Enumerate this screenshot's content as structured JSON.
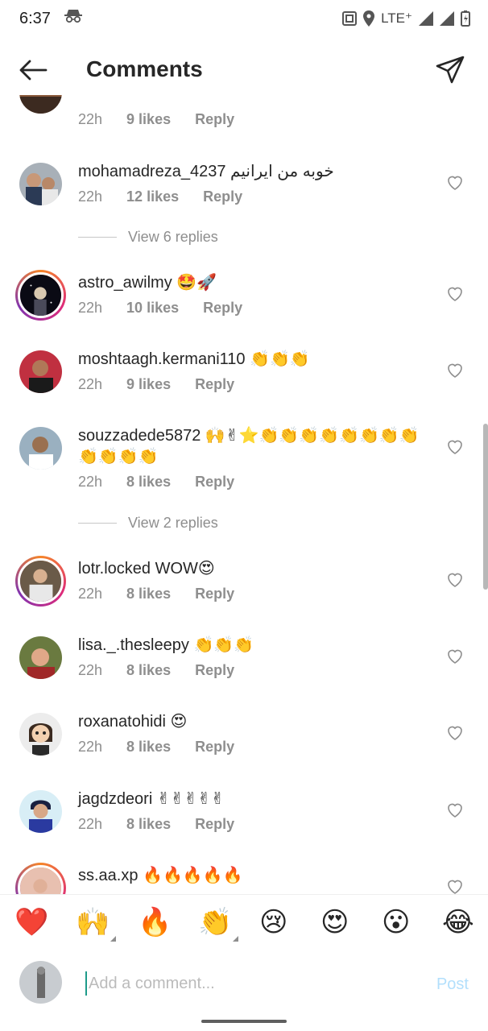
{
  "status_bar": {
    "time": "6:37",
    "network": "LTE⁺"
  },
  "header": {
    "title": "Comments"
  },
  "comments": [
    {
      "username": "",
      "text": "",
      "time": "22h",
      "likes": "9 likes",
      "reply": "Reply"
    },
    {
      "username": "mohamadreza_4237",
      "text": "خوبه من ایرانیم",
      "time": "22h",
      "likes": "12 likes",
      "reply": "Reply"
    },
    {
      "username": "astro_awilmy",
      "text": "🤩🚀",
      "time": "22h",
      "likes": "10 likes",
      "reply": "Reply"
    },
    {
      "username": "moshtaagh.kermani110",
      "text": "👏👏👏",
      "time": "22h",
      "likes": "9 likes",
      "reply": "Reply"
    },
    {
      "username": "souzzadede5872",
      "text": "🙌✌⭐👏👏👏👏👏👏👏👏👏👏👏👏",
      "time": "22h",
      "likes": "8 likes",
      "reply": "Reply"
    },
    {
      "username": "lotr.locked",
      "text": "WOW😍",
      "time": "22h",
      "likes": "8 likes",
      "reply": "Reply"
    },
    {
      "username": "lisa._.thesleepy",
      "text": "👏👏👏",
      "time": "22h",
      "likes": "8 likes",
      "reply": "Reply"
    },
    {
      "username": "roxanatohidi",
      "text": "😍",
      "time": "22h",
      "likes": "8 likes",
      "reply": "Reply"
    },
    {
      "username": "jagdzdeori",
      "text": "✌✌✌✌✌",
      "time": "22h",
      "likes": "8 likes",
      "reply": "Reply"
    },
    {
      "username": "ss.aa.xp",
      "text": "🔥🔥🔥🔥🔥",
      "time": "",
      "likes": "",
      "reply": ""
    }
  ],
  "view_replies": [
    "View 6 replies",
    "View 2 replies"
  ],
  "emoji_bar": [
    "❤️",
    "🙌",
    "🔥",
    "👏",
    "😢",
    "😍",
    "😮",
    "😂"
  ],
  "composer": {
    "placeholder": "Add a comment...",
    "post_label": "Post"
  },
  "colors": {
    "accent_post": "#b2dffc",
    "meta_gray": "#8e8e8e",
    "story_ring_start": "#f58529",
    "story_ring_end": "#dd2a7b"
  }
}
